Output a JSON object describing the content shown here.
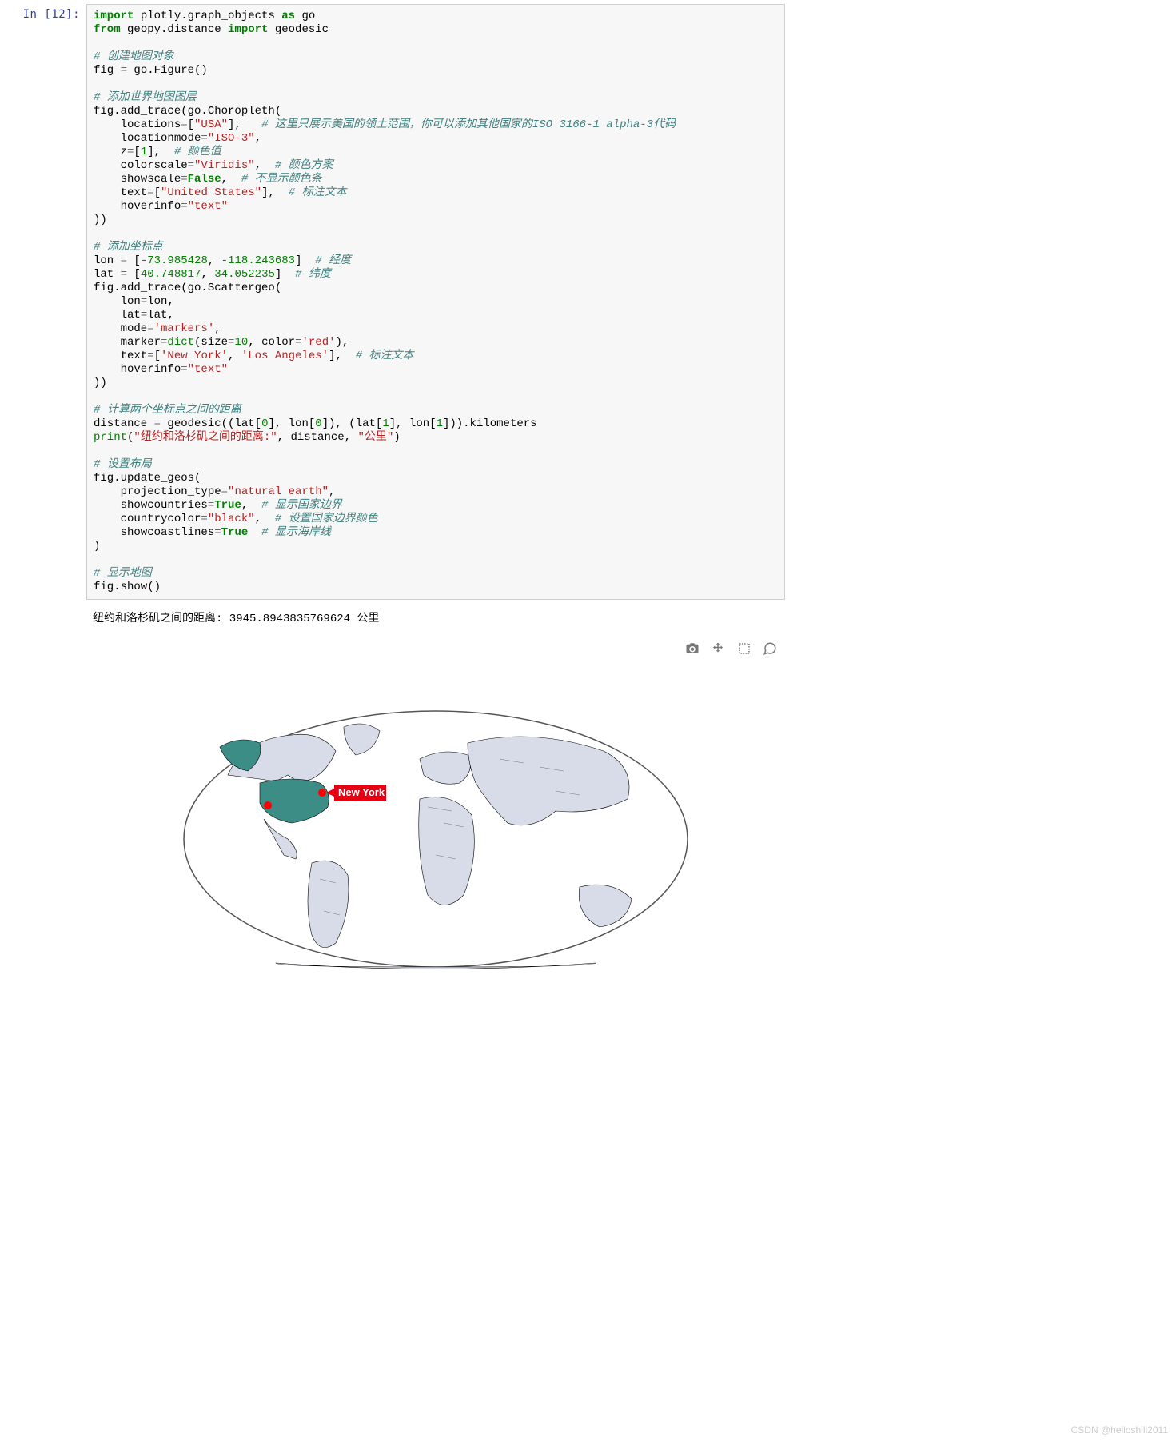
{
  "cell": {
    "prompt": "In [12]:",
    "code_tokens": [
      [
        [
          "kw",
          "import"
        ],
        [
          "var",
          " plotly.graph_objects "
        ],
        [
          "as",
          "as"
        ],
        [
          "var",
          " go"
        ]
      ],
      [
        [
          "kw",
          "from"
        ],
        [
          "var",
          " geopy.distance "
        ],
        [
          "kw",
          "import"
        ],
        [
          "var",
          " geodesic"
        ]
      ],
      [],
      [
        [
          "cm",
          "# 创建地图对象"
        ]
      ],
      [
        [
          "var",
          "fig "
        ],
        [
          "op",
          "="
        ],
        [
          "var",
          " go.Figure()"
        ]
      ],
      [],
      [
        [
          "cm",
          "# 添加世界地图图层"
        ]
      ],
      [
        [
          "var",
          "fig.add_trace(go.Choropleth("
        ]
      ],
      [
        [
          "var",
          "    locations"
        ],
        [
          "op",
          "="
        ],
        [
          "var",
          "["
        ],
        [
          "str",
          "\"USA\""
        ],
        [
          "var",
          "],   "
        ],
        [
          "cm",
          "# 这里只展示美国的领土范围，你可以添加其他国家的ISO 3166-1 alpha-3代码"
        ]
      ],
      [
        [
          "var",
          "    locationmode"
        ],
        [
          "op",
          "="
        ],
        [
          "str",
          "\"ISO-3\""
        ],
        [
          "var",
          ","
        ]
      ],
      [
        [
          "var",
          "    z"
        ],
        [
          "op",
          "="
        ],
        [
          "var",
          "["
        ],
        [
          "num",
          "1"
        ],
        [
          "var",
          "],  "
        ],
        [
          "cm",
          "# 颜色值"
        ]
      ],
      [
        [
          "var",
          "    colorscale"
        ],
        [
          "op",
          "="
        ],
        [
          "str",
          "\"Viridis\""
        ],
        [
          "var",
          ",  "
        ],
        [
          "cm",
          "# 颜色方案"
        ]
      ],
      [
        [
          "var",
          "    showscale"
        ],
        [
          "op",
          "="
        ],
        [
          "bool",
          "False"
        ],
        [
          "var",
          ",  "
        ],
        [
          "cm",
          "# 不显示颜色条"
        ]
      ],
      [
        [
          "var",
          "    text"
        ],
        [
          "op",
          "="
        ],
        [
          "var",
          "["
        ],
        [
          "str",
          "\"United States\""
        ],
        [
          "var",
          "],  "
        ],
        [
          "cm",
          "# 标注文本"
        ]
      ],
      [
        [
          "var",
          "    hoverinfo"
        ],
        [
          "op",
          "="
        ],
        [
          "str",
          "\"text\""
        ]
      ],
      [
        [
          "var",
          "))"
        ]
      ],
      [],
      [
        [
          "cm",
          "# 添加坐标点"
        ]
      ],
      [
        [
          "var",
          "lon "
        ],
        [
          "op",
          "="
        ],
        [
          "var",
          " ["
        ],
        [
          "num",
          "-73.985428"
        ],
        [
          "var",
          ", "
        ],
        [
          "num",
          "-118.243683"
        ],
        [
          "var",
          "]  "
        ],
        [
          "cm",
          "# 经度"
        ]
      ],
      [
        [
          "var",
          "lat "
        ],
        [
          "op",
          "="
        ],
        [
          "var",
          " ["
        ],
        [
          "num",
          "40.748817"
        ],
        [
          "var",
          ", "
        ],
        [
          "num",
          "34.052235"
        ],
        [
          "var",
          "]  "
        ],
        [
          "cm",
          "# 纬度"
        ]
      ],
      [
        [
          "var",
          "fig.add_trace(go.Scattergeo("
        ]
      ],
      [
        [
          "var",
          "    lon"
        ],
        [
          "op",
          "="
        ],
        [
          "var",
          "lon,"
        ]
      ],
      [
        [
          "var",
          "    lat"
        ],
        [
          "op",
          "="
        ],
        [
          "var",
          "lat,"
        ]
      ],
      [
        [
          "var",
          "    mode"
        ],
        [
          "op",
          "="
        ],
        [
          "str",
          "'markers'"
        ],
        [
          "var",
          ","
        ]
      ],
      [
        [
          "var",
          "    marker"
        ],
        [
          "op",
          "="
        ],
        [
          "builtin",
          "dict"
        ],
        [
          "var",
          "(size"
        ],
        [
          "op",
          "="
        ],
        [
          "num",
          "10"
        ],
        [
          "var",
          ", color"
        ],
        [
          "op",
          "="
        ],
        [
          "str",
          "'red'"
        ],
        [
          "var",
          "),"
        ]
      ],
      [
        [
          "var",
          "    text"
        ],
        [
          "op",
          "="
        ],
        [
          "var",
          "["
        ],
        [
          "str",
          "'New York'"
        ],
        [
          "var",
          ", "
        ],
        [
          "str",
          "'Los Angeles'"
        ],
        [
          "var",
          "],  "
        ],
        [
          "cm",
          "# 标注文本"
        ]
      ],
      [
        [
          "var",
          "    hoverinfo"
        ],
        [
          "op",
          "="
        ],
        [
          "str",
          "\"text\""
        ]
      ],
      [
        [
          "var",
          "))"
        ]
      ],
      [],
      [
        [
          "cm",
          "# 计算两个坐标点之间的距离"
        ]
      ],
      [
        [
          "var",
          "distance "
        ],
        [
          "op",
          "="
        ],
        [
          "var",
          " geodesic((lat["
        ],
        [
          "num",
          "0"
        ],
        [
          "var",
          "], lon["
        ],
        [
          "num",
          "0"
        ],
        [
          "var",
          "]), (lat["
        ],
        [
          "num",
          "1"
        ],
        [
          "var",
          "], lon["
        ],
        [
          "num",
          "1"
        ],
        [
          "var",
          "])).kilometers"
        ]
      ],
      [
        [
          "builtin",
          "print"
        ],
        [
          "var",
          "("
        ],
        [
          "str",
          "\"纽约和洛杉矶之间的距离:\""
        ],
        [
          "var",
          ", distance, "
        ],
        [
          "str",
          "\"公里\""
        ],
        [
          "var",
          ")"
        ]
      ],
      [],
      [
        [
          "cm",
          "# 设置布局"
        ]
      ],
      [
        [
          "var",
          "fig.update_geos("
        ]
      ],
      [
        [
          "var",
          "    projection_type"
        ],
        [
          "op",
          "="
        ],
        [
          "str",
          "\"natural earth\""
        ],
        [
          "var",
          ","
        ]
      ],
      [
        [
          "var",
          "    showcountries"
        ],
        [
          "op",
          "="
        ],
        [
          "bool",
          "True"
        ],
        [
          "var",
          ",  "
        ],
        [
          "cm",
          "# 显示国家边界"
        ]
      ],
      [
        [
          "var",
          "    countrycolor"
        ],
        [
          "op",
          "="
        ],
        [
          "str",
          "\"black\""
        ],
        [
          "var",
          ",  "
        ],
        [
          "cm",
          "# 设置国家边界颜色"
        ]
      ],
      [
        [
          "var",
          "    showcoastlines"
        ],
        [
          "op",
          "="
        ],
        [
          "bool",
          "True"
        ],
        [
          "var",
          "  "
        ],
        [
          "cm",
          "# 显示海岸线"
        ]
      ],
      [
        [
          "var",
          ")"
        ]
      ],
      [],
      [
        [
          "cm",
          "# 显示地图"
        ]
      ],
      [
        [
          "var",
          "fig.show()"
        ]
      ]
    ]
  },
  "output": {
    "text": "纽约和洛杉矶之间的距离: 3945.8943835769624 公里"
  },
  "map": {
    "tooltip_label": "New York",
    "points": [
      {
        "name": "New York",
        "lon": -73.985428,
        "lat": 40.748817
      },
      {
        "name": "Los Angeles",
        "lon": -118.243683,
        "lat": 34.052235
      }
    ],
    "highlight_country": "USA",
    "highlight_color": "#3b8d86",
    "land_color": "#d7dce8",
    "border_color": "#000"
  },
  "watermark": "CSDN @helloshili2011",
  "toolbar": {
    "camera": "camera-icon",
    "pan": "pan-icon",
    "select": "box-select-icon",
    "chat": "hover-icon"
  }
}
